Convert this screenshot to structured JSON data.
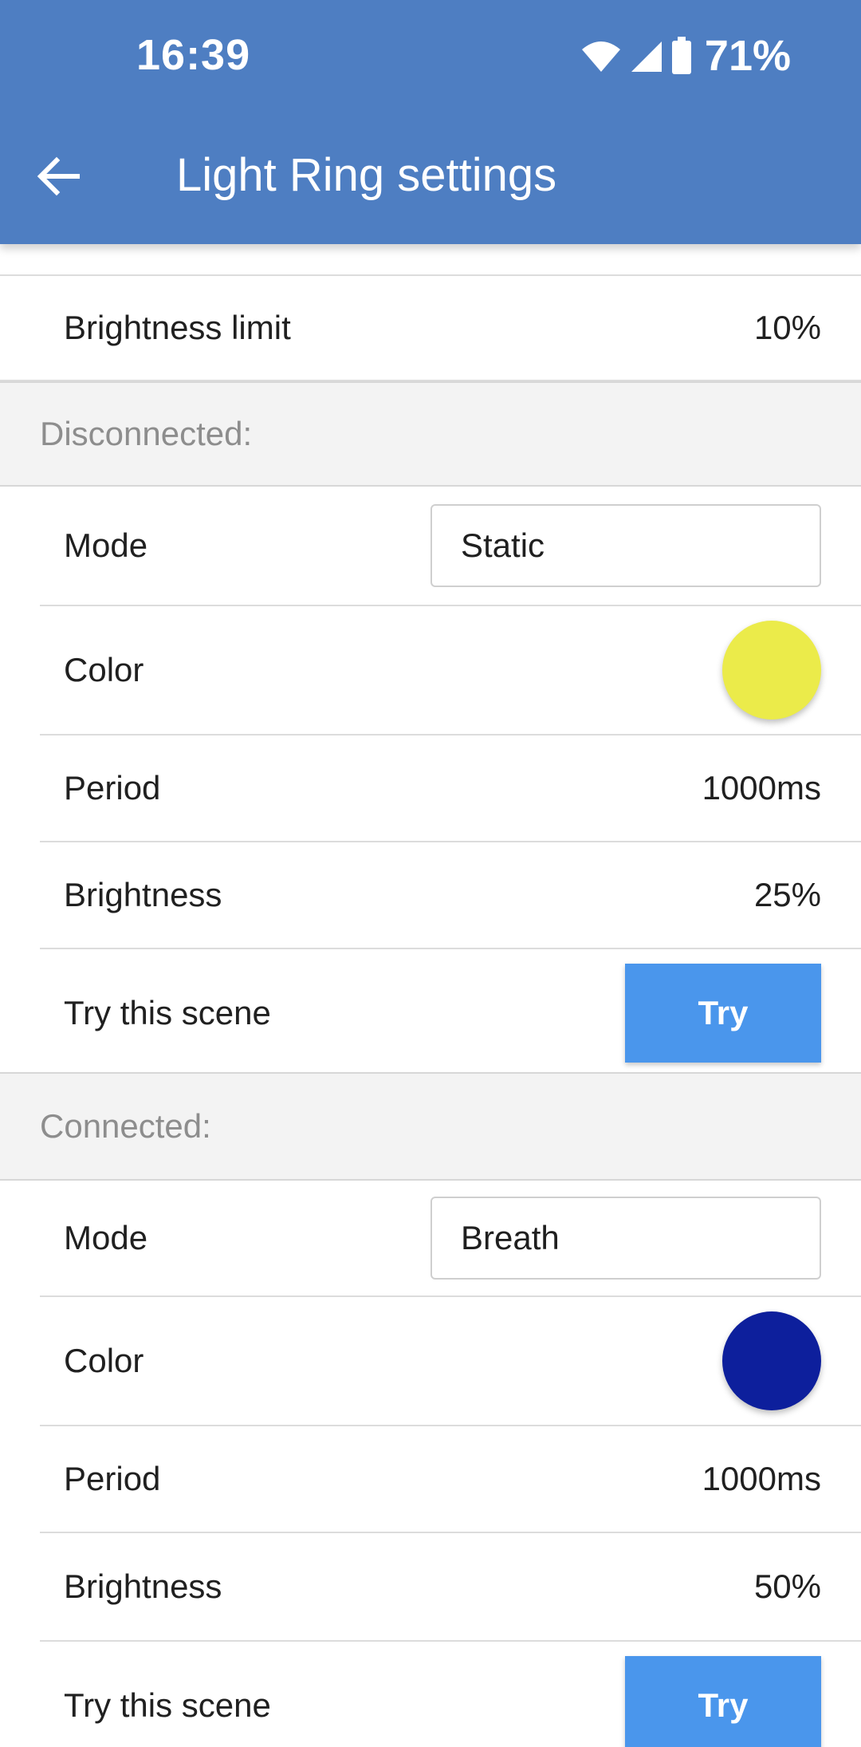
{
  "status_bar": {
    "time": "16:39",
    "battery": "71%",
    "icons": [
      "wifi-icon",
      "signal-icon",
      "battery-icon"
    ]
  },
  "app_bar": {
    "title": "Light Ring settings",
    "back_icon": "arrow-left-icon"
  },
  "brightness_limit": {
    "label": "Brightness limit",
    "value": "10%"
  },
  "disconnected": {
    "header": "Disconnected:",
    "mode_label": "Mode",
    "mode_value": "Static",
    "color_label": "Color",
    "color_value": "#ebeb4a",
    "period_label": "Period",
    "period_value": "1000ms",
    "brightness_label": "Brightness",
    "brightness_value": "25%",
    "try_label": "Try this scene",
    "try_button": "Try"
  },
  "connected": {
    "header": "Connected:",
    "mode_label": "Mode",
    "mode_value": "Breath",
    "color_label": "Color",
    "color_value": "#0d1f9c",
    "period_label": "Period",
    "period_value": "1000ms",
    "brightness_label": "Brightness",
    "brightness_value": "50%",
    "try_label": "Try this scene",
    "try_button": "Try"
  },
  "colors": {
    "app_bar": "#4e7ec2",
    "try_button": "#4a96ec",
    "section_bg": "#f3f3f3"
  }
}
